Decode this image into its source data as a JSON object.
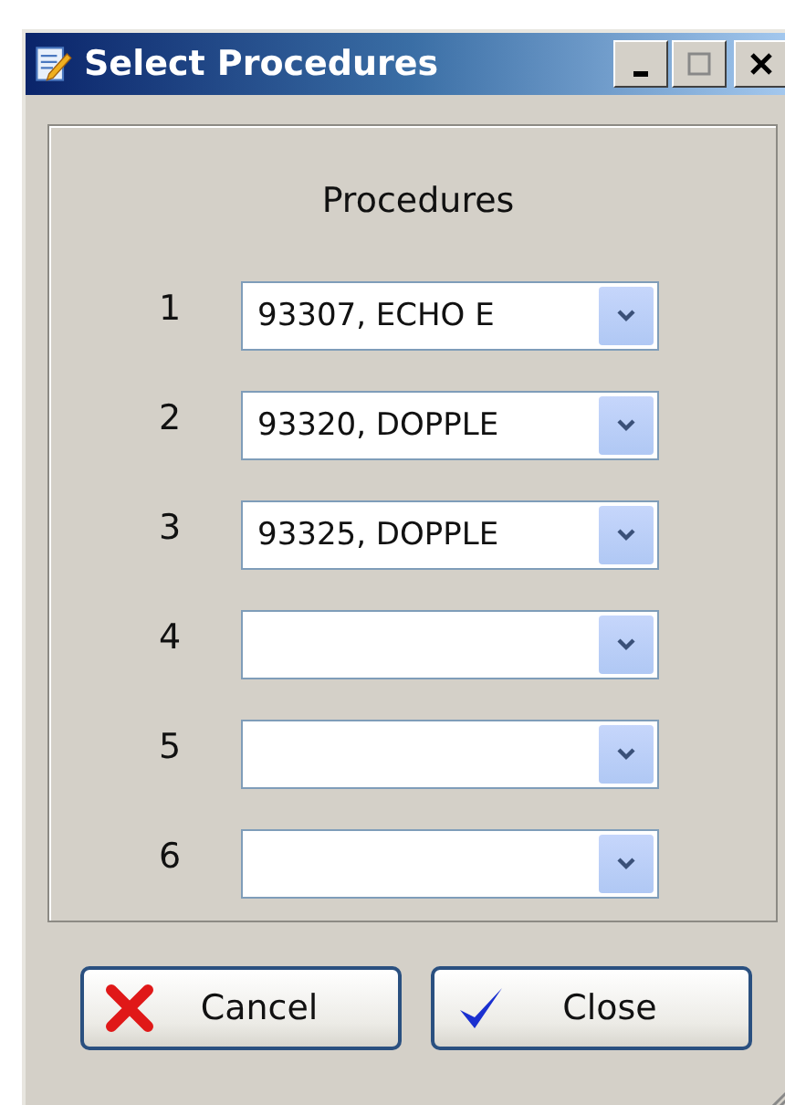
{
  "window": {
    "title": "Select Procedures"
  },
  "title_buttons": [
    {
      "kind": "minimize"
    },
    {
      "kind": "maximize"
    },
    {
      "kind": "close"
    }
  ],
  "heading": "Procedures",
  "procedures": [
    {
      "number": "1",
      "value": "93307, ECHO E"
    },
    {
      "number": "2",
      "value": "93320, DOPPLE"
    },
    {
      "number": "3",
      "value": "93325, DOPPLE"
    },
    {
      "number": "4"
    },
    {
      "number": "5"
    },
    {
      "number": "6"
    }
  ],
  "buttons": [
    {
      "label": "Cancel",
      "kind": "cancel"
    },
    {
      "label": "Close",
      "kind": "ok"
    }
  ]
}
